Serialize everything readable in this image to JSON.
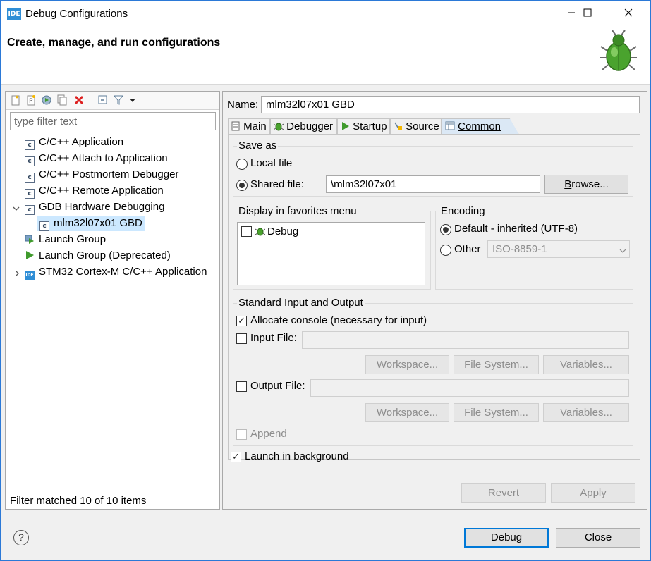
{
  "window": {
    "title": "Debug Configurations",
    "icon_text": "IDE",
    "buttons": [
      "minimize",
      "maximize",
      "close"
    ]
  },
  "header": {
    "title": "Create, manage, and run configurations",
    "icon": "bug-icon"
  },
  "left": {
    "toolbar_icons": [
      "new-configuration-icon",
      "new-prototype-icon",
      "export-icon",
      "duplicate-icon",
      "delete-icon",
      "collapse-all-icon",
      "filter-icon",
      "view-menu-icon"
    ],
    "filter_placeholder": "type filter text",
    "tree": [
      {
        "label": "C/C++ Application",
        "icon": "c-icon"
      },
      {
        "label": "C/C++ Attach to Application",
        "icon": "c-icon"
      },
      {
        "label": "C/C++ Postmortem Debugger",
        "icon": "c-icon"
      },
      {
        "label": "C/C++ Remote Application",
        "icon": "c-icon"
      },
      {
        "label": "GDB Hardware Debugging",
        "icon": "c-icon",
        "expanded": true
      },
      {
        "label": "mlm32l07x01 GBD",
        "icon": "c-icon",
        "selected": true
      },
      {
        "label": "Launch Group",
        "icon": "launch-group-icon"
      },
      {
        "label": "Launch Group (Deprecated)",
        "icon": "play-icon"
      },
      {
        "label": "STM32 Cortex-M C/C++ Application",
        "icon": "ide-icon",
        "collapsed": true
      }
    ],
    "status": "Filter matched 10 of 10 items"
  },
  "right": {
    "name_label": "Name:",
    "name_value": "mlm32l07x01 GBD",
    "tabs": [
      {
        "label": "Main",
        "icon": "main-tab-icon"
      },
      {
        "label": "Debugger",
        "icon": "debugger-tab-icon"
      },
      {
        "label": "Startup",
        "icon": "startup-tab-icon"
      },
      {
        "label": "Source",
        "icon": "source-tab-icon"
      },
      {
        "label": "Common",
        "icon": "common-tab-icon",
        "active": true
      }
    ],
    "save_as": {
      "group_label": "Save as",
      "local_file": "Local file",
      "shared_file": "Shared file:",
      "shared_path": "\\mlm32l07x01",
      "browse": "Browse..."
    },
    "favorites": {
      "group_label": "Display in favorites menu",
      "items": [
        "Debug"
      ]
    },
    "encoding": {
      "group_label": "Encoding",
      "default": "Default - inherited (UTF-8)",
      "other": "Other",
      "other_value": "ISO-8859-1"
    },
    "io": {
      "group_label": "Standard Input and Output",
      "allocate_console": "Allocate console (necessary for input)",
      "input_file": "Input File:",
      "output_file": "Output File:",
      "workspace": "Workspace...",
      "file_system": "File System...",
      "variables": "Variables...",
      "append": "Append"
    },
    "launch_background": "Launch in background",
    "revert": "Revert",
    "apply": "Apply"
  },
  "footer": {
    "help_icon": "?",
    "debug": "Debug",
    "close": "Close"
  }
}
